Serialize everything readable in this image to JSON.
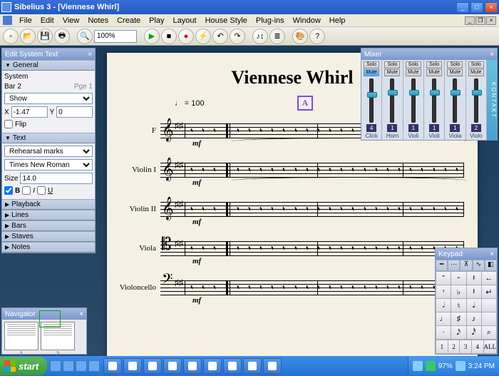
{
  "window": {
    "title": "Sibelius 3 - [Viennese Whirl]"
  },
  "menu": [
    "File",
    "Edit",
    "View",
    "Notes",
    "Create",
    "Play",
    "Layout",
    "House Style",
    "Plug-ins",
    "Window",
    "Help"
  ],
  "toolbar": {
    "zoom": "100%"
  },
  "score": {
    "title": "Viennese Whirl",
    "tempo_note": "♩",
    "tempo_eq": "= 100",
    "rehearsal": "A",
    "dynamic": "mf",
    "instruments": [
      "F",
      "Violin I",
      "Violin II",
      "Viola",
      "Violoncello"
    ]
  },
  "props": {
    "title": "Edit System Text",
    "sections": {
      "general": "General",
      "text": "Text",
      "playback": "Playback",
      "lines": "Lines",
      "bars": "Bars",
      "staves": "Staves",
      "notes": "Notes"
    },
    "general": {
      "system": "System",
      "bar": "Bar 2",
      "page_label": "Pge 1",
      "show": "Show",
      "x_label": "X",
      "x_val": "-1.47",
      "y_label": "Y",
      "y_val": "0",
      "flip": "Flip"
    },
    "text": {
      "style": "Rehearsal marks",
      "font": "Times New Roman",
      "size_label": "Size",
      "size_val": "14.0",
      "b": "B",
      "i": "I",
      "u": "U"
    }
  },
  "navigator": {
    "title": "Navigator",
    "pages": [
      "1",
      "2"
    ]
  },
  "mixer": {
    "title": "Mixer",
    "solo": "Solo",
    "mute": "Mute",
    "channels": [
      {
        "num": "4",
        "label": "Click",
        "pos": 30
      },
      {
        "num": "1",
        "label": "Horn",
        "pos": 25
      },
      {
        "num": "1",
        "label": "Violi",
        "pos": 25
      },
      {
        "num": "1",
        "label": "Violi",
        "pos": 25
      },
      {
        "num": "1",
        "label": "Viola",
        "pos": 25
      },
      {
        "num": "2",
        "label": "Violo",
        "pos": 25
      }
    ],
    "side": "KONTAKT"
  },
  "keypad": {
    "title": "Keypad",
    "grid": [
      "𝄻",
      "𝄼",
      "𝄽",
      "←",
      "𝄾",
      "♭",
      "𝄽",
      "↵",
      "𝅗𝅥",
      "♮",
      "𝅘𝅥",
      "",
      "♩",
      "♯",
      "♪",
      "",
      "·",
      "𝅘𝅥𝅯",
      "𝅘𝅥𝅰",
      "⌕"
    ],
    "bottom": [
      "1",
      "2",
      "3",
      "4",
      "ALL"
    ]
  },
  "taskbar": {
    "start": "start",
    "tasks": [
      "",
      "",
      "",
      "",
      "",
      "",
      "",
      "",
      ""
    ],
    "cpu": "97%",
    "clock": "3:24 PM"
  }
}
